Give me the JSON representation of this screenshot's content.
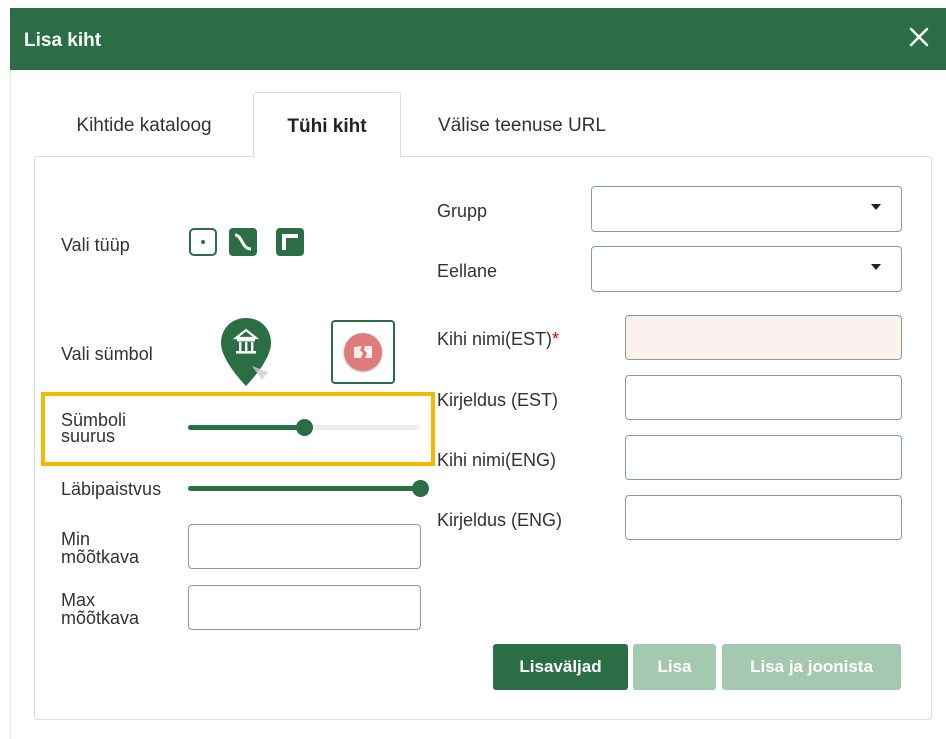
{
  "dialog": {
    "title": "Lisa kiht",
    "close_icon": "close-icon"
  },
  "tabs": [
    {
      "label": "Kihtide kataloog",
      "active": false
    },
    {
      "label": "Tühi kiht",
      "active": true
    },
    {
      "label": "Välise teenuse URL",
      "active": false
    }
  ],
  "left": {
    "type_label": "Vali tüüp",
    "type_icons": [
      "point-type-icon",
      "line-type-icon",
      "polygon-type-icon"
    ],
    "symbol_label": "Vali sümbol",
    "symbol_icons": [
      "building-marker-icon",
      "image-symbol-icon"
    ],
    "symbol_size_label_1": "Sümboli",
    "symbol_size_label_2": "suurus",
    "symbol_size_value": 0.5,
    "opacity_label": "Läbipaistvus",
    "opacity_value": 1.0,
    "min_scale_label_1": "Min",
    "min_scale_label_2": "mõõtkava",
    "min_scale_value": "",
    "max_scale_label_1": "Max",
    "max_scale_label_2": "mõõtkava",
    "max_scale_value": ""
  },
  "right": {
    "group_label": "Grupp",
    "group_value": "",
    "parent_label": "Eellane",
    "parent_value": "",
    "name_est_label": "Kihi nimi(EST)",
    "required_mark": "*",
    "name_est_value": "",
    "desc_est_label": "Kirjeldus (EST)",
    "desc_est_value": "",
    "name_eng_label": "Kihi nimi(ENG)",
    "name_eng_value": "",
    "desc_eng_label": "Kirjeldus (ENG)",
    "desc_eng_value": ""
  },
  "buttons": {
    "extra_fields": "Lisaväljad",
    "add": "Lisa",
    "add_and_draw": "Lisa ja joonista"
  },
  "colors": {
    "brand": "#2b6e45",
    "disabled": "#a5c8b1",
    "highlight": "#f5b800",
    "required": "#d40000"
  }
}
